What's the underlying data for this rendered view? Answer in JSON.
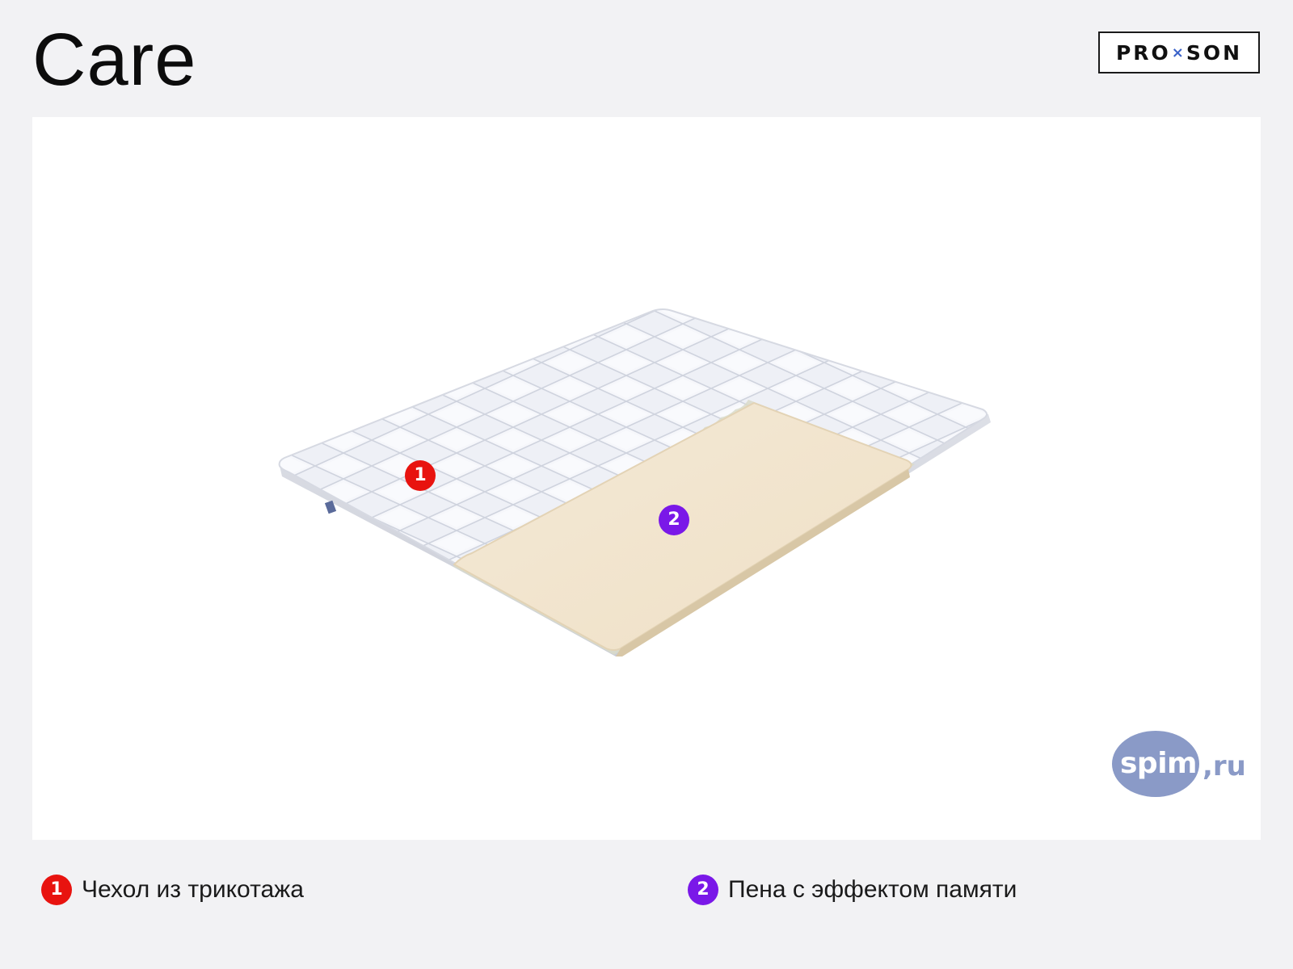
{
  "header": {
    "title": "Care"
  },
  "brand": {
    "name_left": "PRO",
    "name_separator": "×",
    "name_right": "SON",
    "separator_color": "#3a62c9"
  },
  "illustration": {
    "markers": [
      {
        "number": "1",
        "color": "#e8130f"
      },
      {
        "number": "2",
        "color": "#7a18e8"
      }
    ]
  },
  "watermark": {
    "text": "spim",
    "suffix": ",ru",
    "color": "#8a9ac7"
  },
  "legend": {
    "items": [
      {
        "number": "1",
        "label": "Чехол из трикотажа",
        "color": "#e8130f"
      },
      {
        "number": "2",
        "label": "Пена с эффектом памяти",
        "color": "#7a18e8"
      }
    ]
  }
}
